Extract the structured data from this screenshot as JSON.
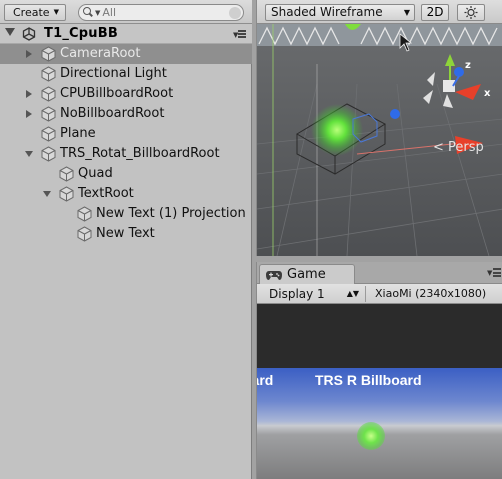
{
  "hierarchy": {
    "create_label": "Create",
    "search_placeholder": "All",
    "scene_name": "T1_CpuBB",
    "items": [
      {
        "label": "CameraRoot",
        "depth": 0,
        "fold": "closed",
        "selected": true
      },
      {
        "label": "Directional Light",
        "depth": 0,
        "fold": "none",
        "selected": false
      },
      {
        "label": "CPUBillboardRoot",
        "depth": 0,
        "fold": "closed",
        "selected": false
      },
      {
        "label": "NoBillboardRoot",
        "depth": 0,
        "fold": "closed",
        "selected": false
      },
      {
        "label": "Plane",
        "depth": 0,
        "fold": "none",
        "selected": false
      },
      {
        "label": "TRS_Rotat_BillboardRoot",
        "depth": 0,
        "fold": "open",
        "selected": false
      },
      {
        "label": "Quad",
        "depth": 1,
        "fold": "none",
        "selected": false
      },
      {
        "label": "TextRoot",
        "depth": 1,
        "fold": "open",
        "selected": false
      },
      {
        "label": "New Text (1) Projection",
        "depth": 2,
        "fold": "none",
        "selected": false
      },
      {
        "label": "New Text",
        "depth": 2,
        "fold": "none",
        "selected": false
      }
    ]
  },
  "scene_view": {
    "shading_mode": "Shaded Wireframe",
    "mode_2d_label": "2D",
    "light_icon": "sun-icon",
    "persp_label": "< Persp",
    "axis_x_label": "x",
    "axis_z_label": "z"
  },
  "game_view": {
    "tab_label": "Game",
    "display_label": "Display 1",
    "resolution_label": "XiaoMi (2340x1080)",
    "title_text": "TRS R Billboard",
    "cut_text": "oard"
  },
  "colors": {
    "selection": "#8f8f8f",
    "panel_bg": "#c2c2c2",
    "scene_bg": "#585a5c",
    "green_sphere": "#6ee34b",
    "axis_red": "#e8402a",
    "axis_green": "#8ed43a",
    "axis_blue": "#3a6fe8"
  }
}
